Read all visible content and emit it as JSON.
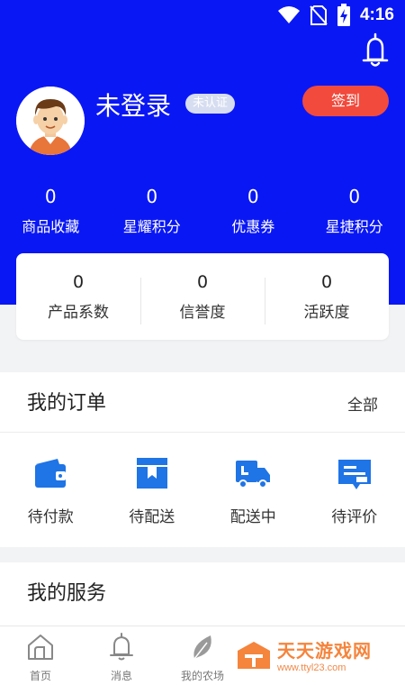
{
  "status_bar": {
    "time": "4:16"
  },
  "profile": {
    "username": "未登录",
    "auth_badge": "未认证",
    "signin_label": "签到"
  },
  "stats": [
    {
      "value": "0",
      "label": "商品收藏"
    },
    {
      "value": "0",
      "label": "星耀积分"
    },
    {
      "value": "0",
      "label": "优惠券"
    },
    {
      "value": "0",
      "label": "星捷积分"
    }
  ],
  "card": [
    {
      "value": "0",
      "label": "产品系数"
    },
    {
      "value": "0",
      "label": "信誉度"
    },
    {
      "value": "0",
      "label": "活跃度"
    }
  ],
  "orders": {
    "title": "我的订单",
    "all_label": "全部",
    "items": [
      {
        "label": "待付款",
        "icon": "wallet-icon"
      },
      {
        "label": "待配送",
        "icon": "package-icon"
      },
      {
        "label": "配送中",
        "icon": "truck-icon"
      },
      {
        "label": "待评价",
        "icon": "comment-icon"
      }
    ]
  },
  "services": {
    "title": "我的服务"
  },
  "tabbar": [
    {
      "label": "首页",
      "icon": "home-icon"
    },
    {
      "label": "消息",
      "icon": "bell-icon"
    },
    {
      "label": "我的农场",
      "icon": "leaf-icon"
    }
  ],
  "watermark": {
    "main": "天天游戏网",
    "sub": "www.ttyl23.com"
  },
  "colors": {
    "primary": "#0a17f5",
    "accent_button": "#f24a3c",
    "icon_blue": "#1f74e6"
  }
}
